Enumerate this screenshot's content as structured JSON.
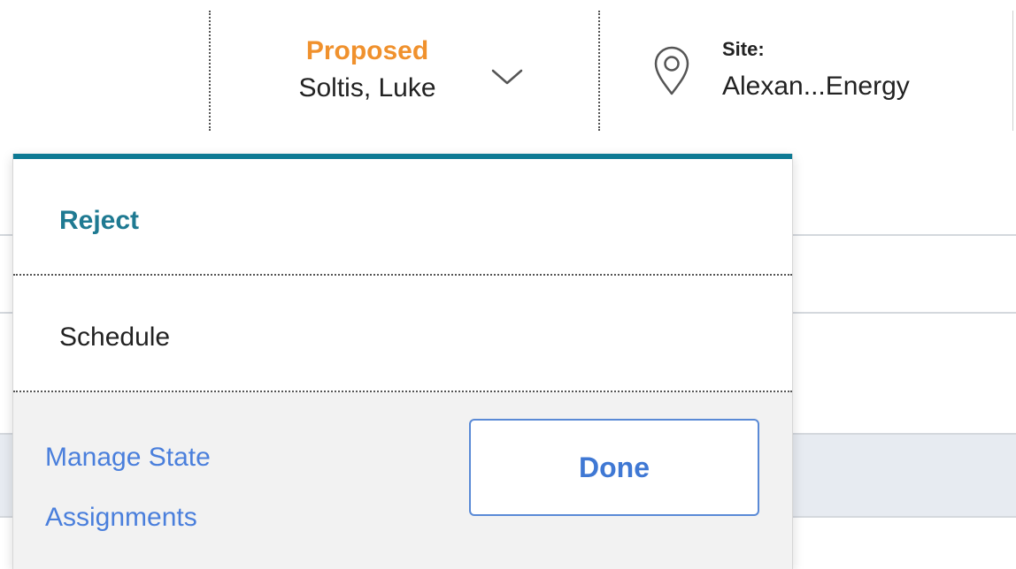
{
  "header": {
    "state": {
      "name": "Proposed",
      "owner": "Soltis, Luke",
      "name_color": "#f0912d",
      "toggle_icon": "chevron-down-icon"
    },
    "site": {
      "icon": "location-pin-icon",
      "label": "Site:",
      "value": "Alexan...Energy"
    }
  },
  "dropdown": {
    "accent_color": "#0e7a94",
    "transitions": [
      {
        "label": "Reject",
        "emphasized": true
      },
      {
        "label": "Schedule",
        "emphasized": false
      }
    ],
    "manage_link": "Manage State Assignments",
    "done_label": "Done"
  }
}
